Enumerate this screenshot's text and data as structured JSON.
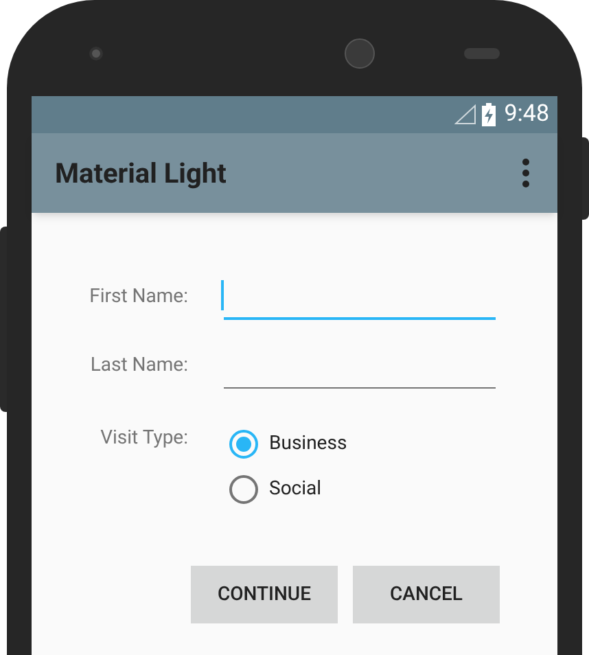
{
  "status_bar": {
    "time": "9:48"
  },
  "app_bar": {
    "title": "Material Light"
  },
  "fields": [
    {
      "label": "First Name:",
      "focused": true
    },
    {
      "label": "Last Name:",
      "focused": false
    }
  ],
  "visit_type": {
    "label": "Visit Type:",
    "options": [
      {
        "label": "Business",
        "selected": true
      },
      {
        "label": "Social",
        "selected": false
      }
    ]
  },
  "buttons": [
    "CONTINUE",
    "CANCEL"
  ]
}
